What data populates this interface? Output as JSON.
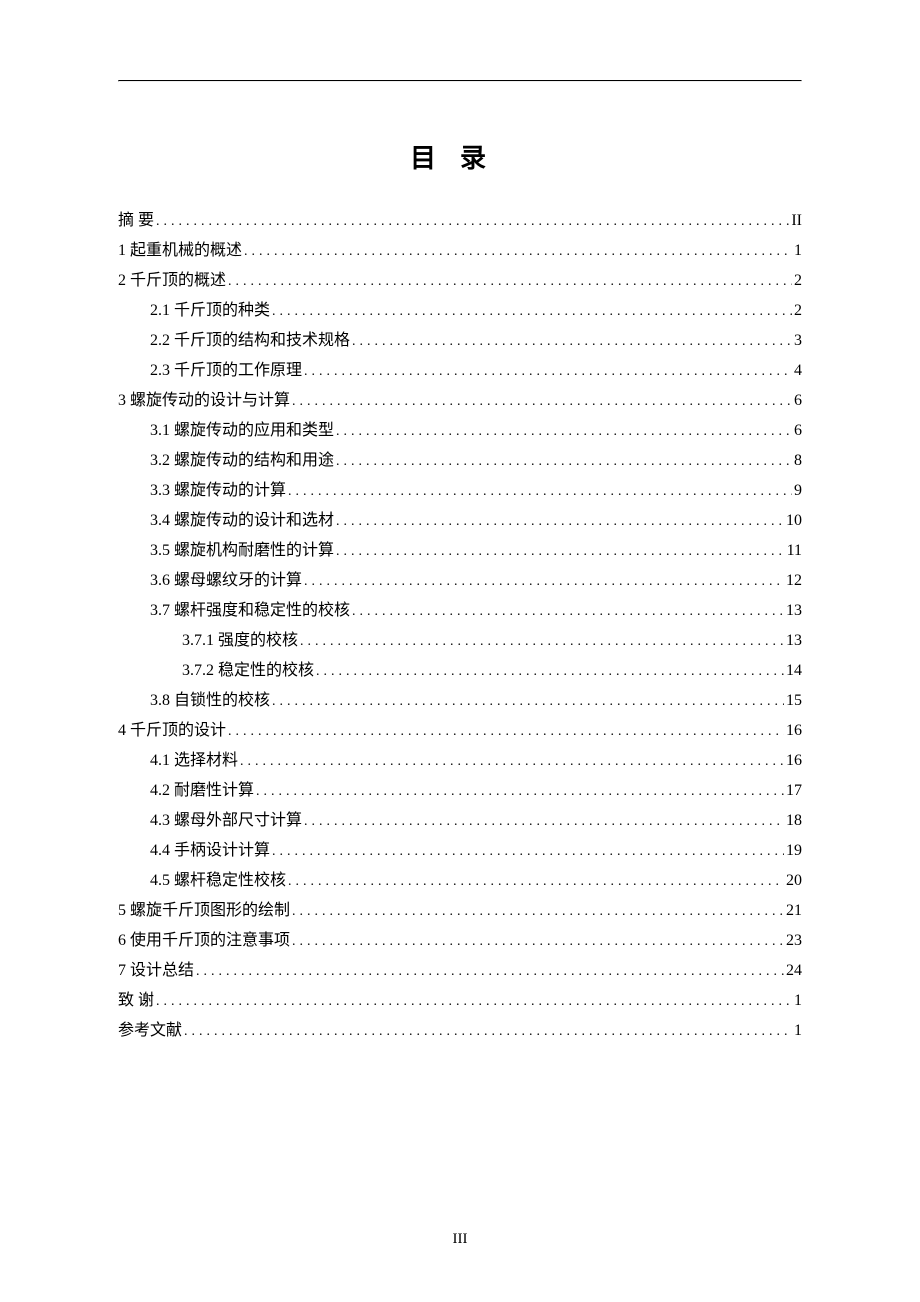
{
  "title": "目录",
  "page_number": "III",
  "toc": [
    {
      "indent": 0,
      "label": "摘    要",
      "page": "II",
      "spaced": true
    },
    {
      "indent": 0,
      "label": "1 起重机械的概述",
      "page": "1"
    },
    {
      "indent": 0,
      "label": "2 千斤顶的概述",
      "page": "2"
    },
    {
      "indent": 1,
      "label": "2.1 千斤顶的种类",
      "page": "2"
    },
    {
      "indent": 1,
      "label": "2.2 千斤顶的结构和技术规格",
      "page": "3"
    },
    {
      "indent": 1,
      "label": "2.3 千斤顶的工作原理",
      "page": "4"
    },
    {
      "indent": 0,
      "label": "3 螺旋传动的设计与计算",
      "page": "6"
    },
    {
      "indent": 1,
      "label": "3.1 螺旋传动的应用和类型",
      "page": "6"
    },
    {
      "indent": 1,
      "label": "3.2 螺旋传动的结构和用途",
      "page": "8"
    },
    {
      "indent": 1,
      "label": "3.3 螺旋传动的计算",
      "page": "9"
    },
    {
      "indent": 1,
      "label": "3.4 螺旋传动的设计和选材",
      "page": "10"
    },
    {
      "indent": 1,
      "label": "3.5 螺旋机构耐磨性的计算",
      "page": "11"
    },
    {
      "indent": 1,
      "label": "3.6 螺母螺纹牙的计算",
      "page": "12"
    },
    {
      "indent": 1,
      "label": "3.7 螺杆强度和稳定性的校核",
      "page": "13"
    },
    {
      "indent": 2,
      "label": "3.7.1 强度的校核",
      "page": "13"
    },
    {
      "indent": 2,
      "label": "3.7.2 稳定性的校核",
      "page": "14"
    },
    {
      "indent": 1,
      "label": "3.8 自锁性的校核",
      "page": "15"
    },
    {
      "indent": 0,
      "label": "4 千斤顶的设计",
      "page": "16"
    },
    {
      "indent": 1,
      "label": "4.1 选择材料",
      "page": "16"
    },
    {
      "indent": 1,
      "label": "4.2 耐磨性计算",
      "page": "17"
    },
    {
      "indent": 1,
      "label": "4.3 螺母外部尺寸计算",
      "page": "18"
    },
    {
      "indent": 1,
      "label": "4.4 手柄设计计算",
      "page": "19"
    },
    {
      "indent": 1,
      "label": "4.5 螺杆稳定性校核",
      "page": "20"
    },
    {
      "indent": 0,
      "label": "5 螺旋千斤顶图形的绘制",
      "page": "21"
    },
    {
      "indent": 0,
      "label": "6 使用千斤顶的注意事项",
      "page": "23"
    },
    {
      "indent": 0,
      "label": "7 设计总结",
      "page": "24"
    },
    {
      "indent": 0,
      "label": "致    谢",
      "page": "1",
      "spaced": true
    },
    {
      "indent": 0,
      "label": "参考文献",
      "page": "1"
    }
  ]
}
